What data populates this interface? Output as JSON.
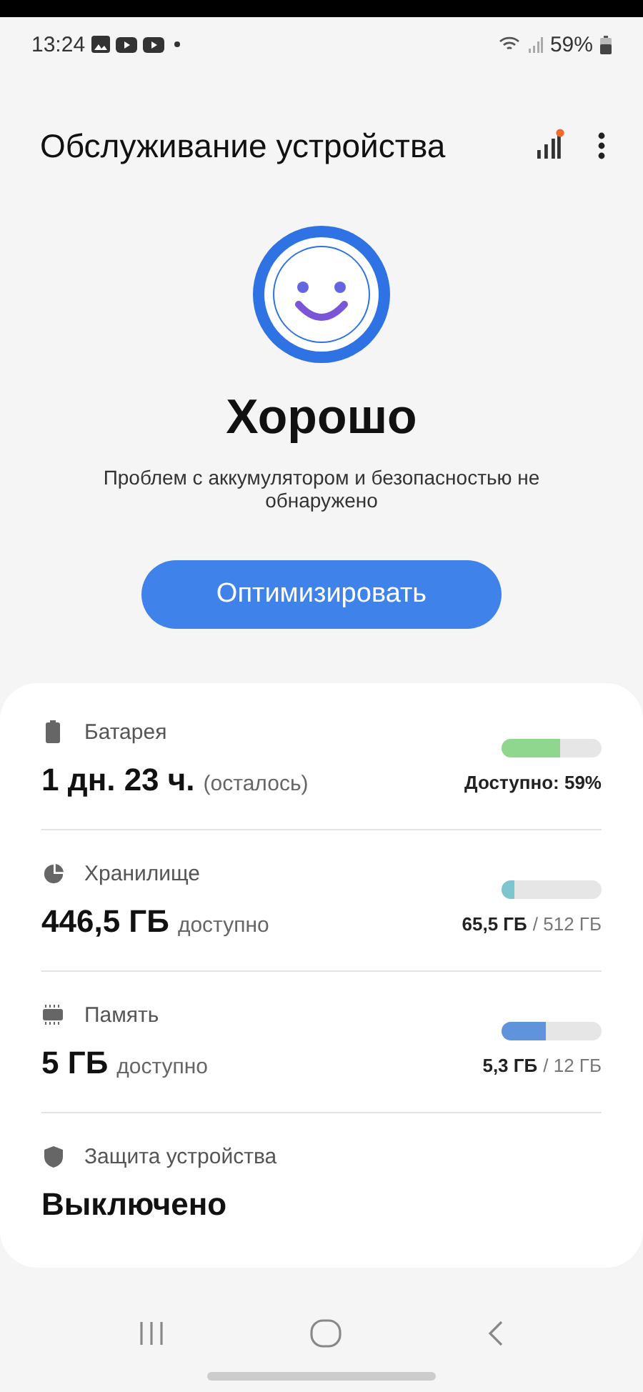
{
  "status_bar": {
    "time": "13:24",
    "battery_percent": "59%"
  },
  "header": {
    "title": "Обслуживание устройства",
    "notification_dot": true
  },
  "status": {
    "headline": "Хорошо",
    "message": "Проблем с аккумулятором и безопасностью не обнаружено",
    "button": "Оптимизировать"
  },
  "items": [
    {
      "kind": "meter",
      "label": "Батарея",
      "value": "1 дн. 23 ч.",
      "value_note": "(осталось)",
      "level": 0.59,
      "color": "#8fd68f",
      "caption_strong": "Доступно: 59%"
    },
    {
      "kind": "meter",
      "label": "Хранилище",
      "value": "446,5 ГБ",
      "value_note": "доступно",
      "level": 0.13,
      "color": "#7ec6cf",
      "caption_strong": "65,5 ГБ",
      "caption_rest": "/ 512 ГБ"
    },
    {
      "kind": "meter",
      "label": "Память",
      "value": "5 ГБ",
      "value_note": "доступно",
      "level": 0.44,
      "color": "#5f93dc",
      "caption_strong": "5,3 ГБ",
      "caption_rest": "/ 12 ГБ"
    },
    {
      "kind": "plain",
      "label": "Защита устройства",
      "value": "Выключено"
    }
  ]
}
